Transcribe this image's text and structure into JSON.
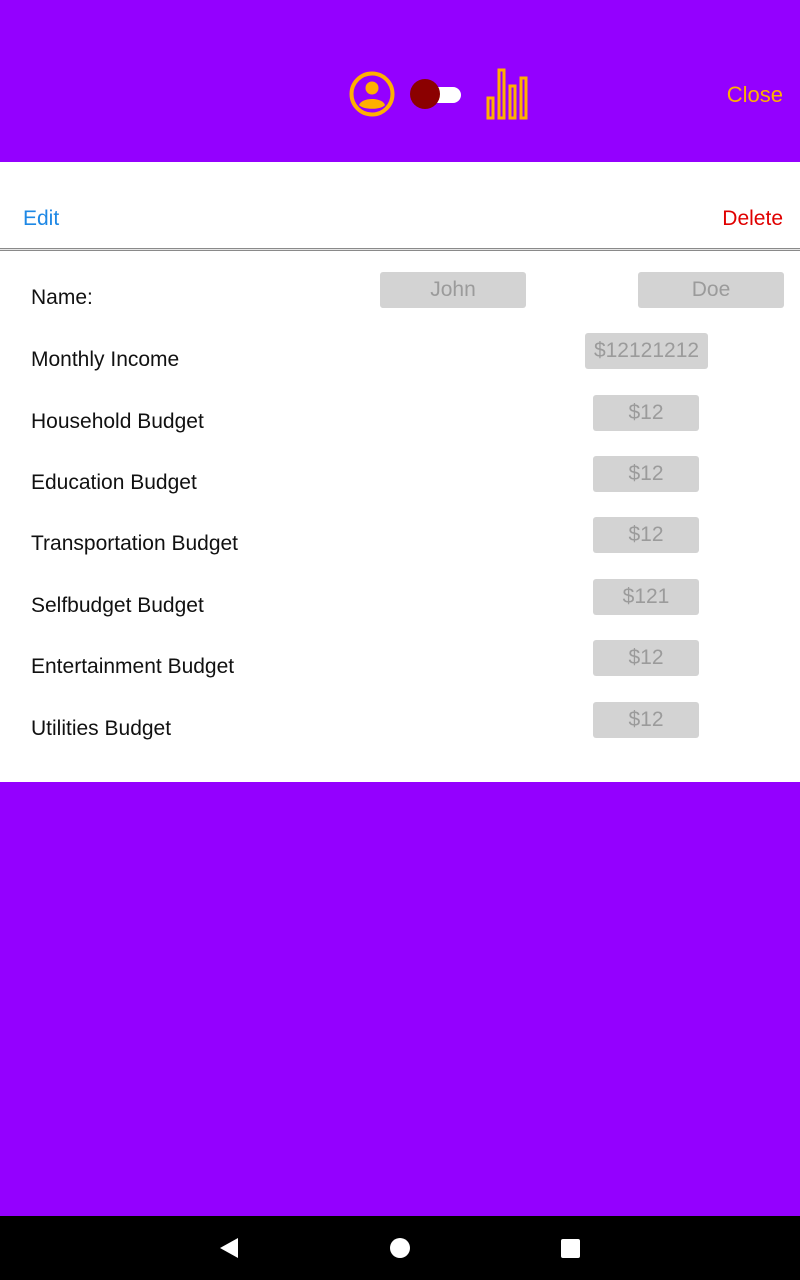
{
  "header": {
    "close_label": "Close",
    "icons": [
      "account-circle-icon",
      "toggle-switch",
      "bar-chart-icon"
    ],
    "accent_color": "#ffb000",
    "background_color": "#9400ff"
  },
  "actions": {
    "edit_label": "Edit",
    "delete_label": "Delete"
  },
  "form": {
    "name": {
      "label": "Name:",
      "first_placeholder": "John",
      "last_placeholder": "Doe"
    },
    "income": {
      "label": "Monthly Income",
      "placeholder": "$12121212"
    },
    "budgets": [
      {
        "label": "Household Budget",
        "placeholder": "$12"
      },
      {
        "label": "Education Budget",
        "placeholder": "$12"
      },
      {
        "label": "Transportation Budget",
        "placeholder": "$12"
      },
      {
        "label": "Selfbudget Budget",
        "placeholder": "$121"
      },
      {
        "label": "Entertainment Budget",
        "placeholder": "$12"
      },
      {
        "label": "Utilities Budget",
        "placeholder": "$12"
      }
    ]
  },
  "navbar": {
    "icons": [
      "back-icon",
      "home-icon",
      "recent-apps-icon"
    ]
  }
}
